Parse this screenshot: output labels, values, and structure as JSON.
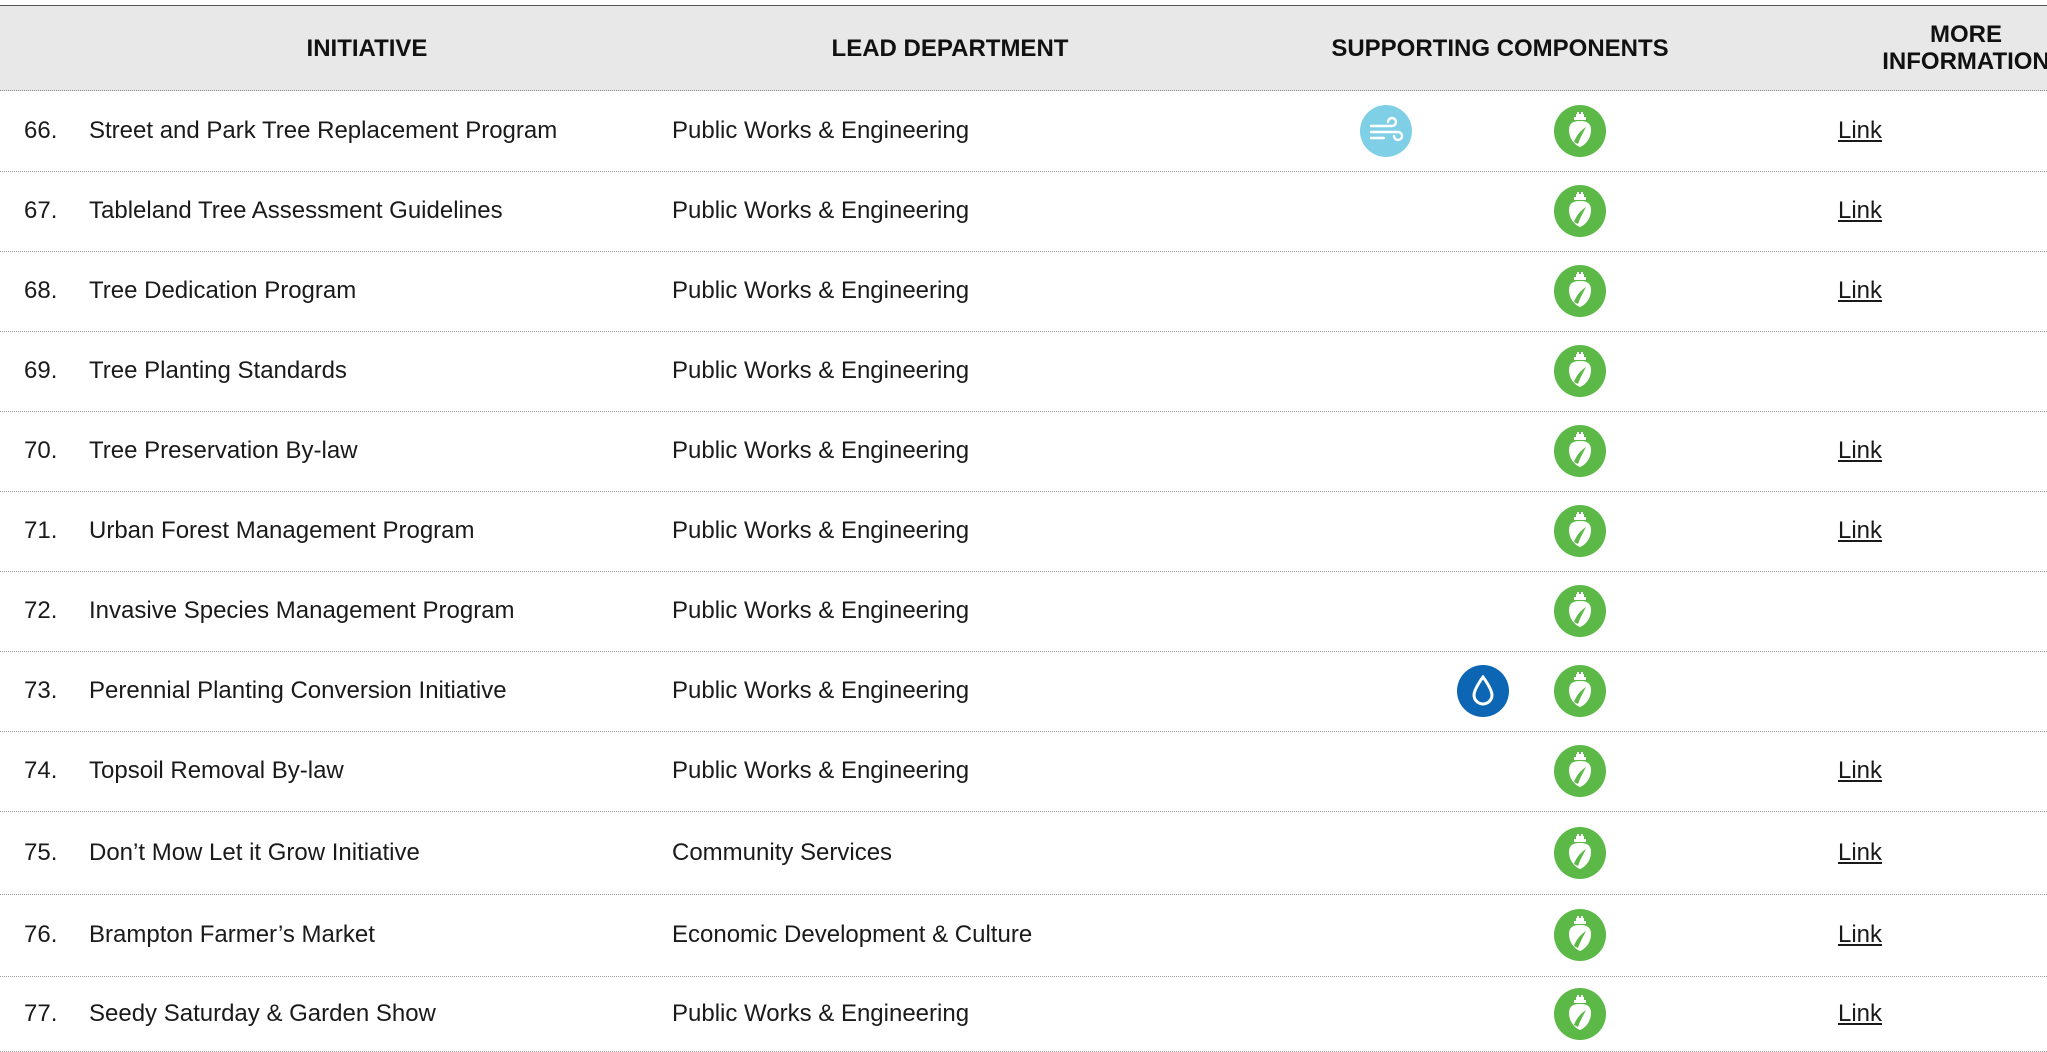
{
  "header": {
    "initiative": "INITIATIVE",
    "lead_department": "LEAD DEPARTMENT",
    "supporting_components": "SUPPORTING COMPONENTS",
    "more_information_line1": "MORE",
    "more_information_line2": "INFORMATION"
  },
  "icons": {
    "green": "green-infrastructure-icon",
    "air": "air-wind-icon",
    "water": "water-drop-icon"
  },
  "colors": {
    "header_bg": "#e8e8e9",
    "green_icon": "#5cb947",
    "air_icon": "#7fd0e6",
    "water_icon": "#0d66b3"
  },
  "rows": [
    {
      "num": "66.",
      "initiative": "Street and Park Tree Replacement Program",
      "department": "Public Works & Engineering",
      "components": [
        "air",
        "green"
      ],
      "link": "Link"
    },
    {
      "num": "67.",
      "initiative": "Tableland Tree Assessment Guidelines",
      "department": "Public Works & Engineering",
      "components": [
        "green"
      ],
      "link": "Link"
    },
    {
      "num": "68.",
      "initiative": "Tree Dedication Program",
      "department": "Public Works & Engineering",
      "components": [
        "green"
      ],
      "link": "Link"
    },
    {
      "num": "69.",
      "initiative": "Tree Planting Standards",
      "department": "Public Works & Engineering",
      "components": [
        "green"
      ],
      "link": ""
    },
    {
      "num": "70.",
      "initiative": "Tree Preservation By-law",
      "department": "Public Works & Engineering",
      "components": [
        "green"
      ],
      "link": "Link"
    },
    {
      "num": "71.",
      "initiative": "Urban Forest Management Program",
      "department": "Public Works & Engineering",
      "components": [
        "green"
      ],
      "link": "Link"
    },
    {
      "num": "72.",
      "initiative": "Invasive Species Management Program",
      "department": "Public Works & Engineering",
      "components": [
        "green"
      ],
      "link": ""
    },
    {
      "num": "73.",
      "initiative": "Perennial Planting Conversion Initiative",
      "department": "Public Works & Engineering",
      "components": [
        "water",
        "green"
      ],
      "link": ""
    },
    {
      "num": "74.",
      "initiative": "Topsoil Removal By-law",
      "department": "Public Works & Engineering",
      "components": [
        "green"
      ],
      "link": "Link"
    },
    {
      "num": "75.",
      "initiative": "Don’t Mow Let it Grow Initiative",
      "department": "Community Services",
      "components": [
        "green"
      ],
      "link": "Link"
    },
    {
      "num": "76.",
      "initiative": "Brampton Farmer’s Market",
      "department": "Economic Development & Culture",
      "components": [
        "green"
      ],
      "link": "Link"
    },
    {
      "num": "77.",
      "initiative": "Seedy Saturday & Garden Show",
      "department": "Public Works & Engineering",
      "components": [
        "green"
      ],
      "link": "Link"
    }
  ]
}
